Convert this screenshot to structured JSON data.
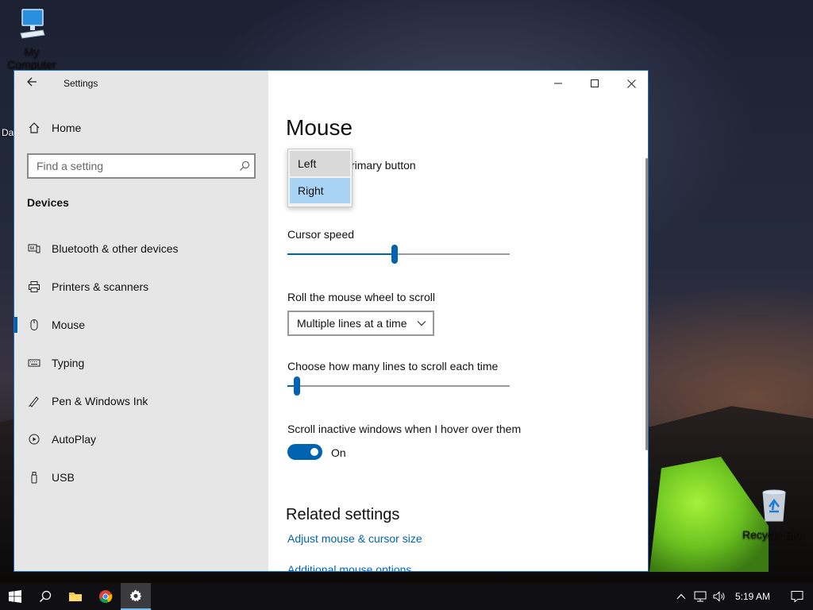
{
  "desktop": {
    "icons": [
      {
        "label": "My Computer"
      },
      {
        "label": "Recycle Bin"
      }
    ],
    "partial_label": "Da"
  },
  "window": {
    "app_title": "Settings",
    "sidebar": {
      "home_label": "Home",
      "search_placeholder": "Find a setting",
      "section_heading": "Devices",
      "items": [
        {
          "label": "Bluetooth & other devices",
          "icon": "bluetooth-devices-icon"
        },
        {
          "label": "Printers & scanners",
          "icon": "printer-icon"
        },
        {
          "label": "Mouse",
          "icon": "mouse-icon",
          "selected": true
        },
        {
          "label": "Typing",
          "icon": "keyboard-icon"
        },
        {
          "label": "Pen & Windows Ink",
          "icon": "pen-icon"
        },
        {
          "label": "AutoPlay",
          "icon": "autoplay-icon"
        },
        {
          "label": "USB",
          "icon": "usb-icon"
        }
      ]
    },
    "content": {
      "page_title": "Mouse",
      "primary_button_label": "rimary button",
      "primary_button_options": [
        "Left",
        "Right"
      ],
      "primary_button_selected": "Right",
      "cursor_speed_label": "Cursor speed",
      "cursor_speed_value": 0.48,
      "scroll_label": "Roll the mouse wheel to scroll",
      "scroll_value": "Multiple lines at a time",
      "lines_label": "Choose how many lines to scroll each time",
      "lines_value": 0.03,
      "inactive_label": "Scroll inactive windows when I hover over them",
      "inactive_state": "On",
      "related_title": "Related settings",
      "links": [
        "Adjust mouse & cursor size",
        "Additional mouse options"
      ]
    }
  },
  "taskbar": {
    "time": "5:19 AM",
    "active_app": "settings-icon"
  },
  "colors": {
    "accent": "#0063b1",
    "sidebar_bg": "#e6e6e6",
    "taskbar_bg": "#101014",
    "selected_option": "#a8d3f5"
  }
}
